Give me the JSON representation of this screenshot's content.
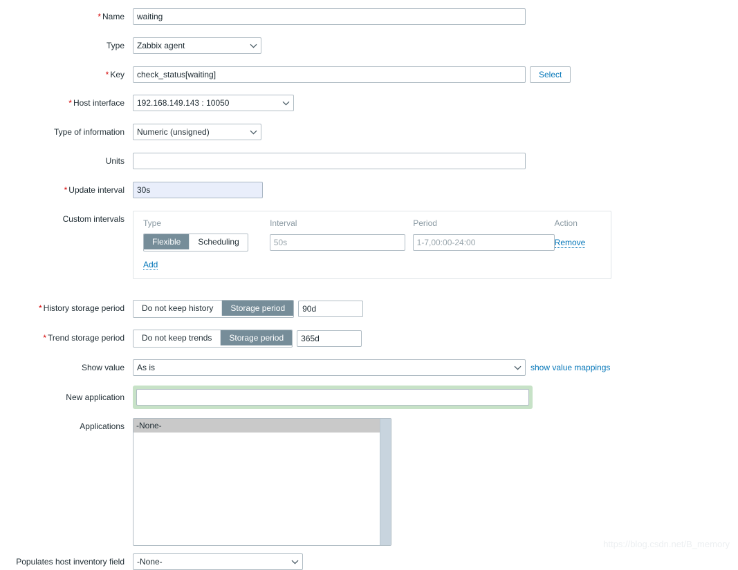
{
  "form": {
    "name": {
      "label": "Name",
      "required": true,
      "value": "waiting"
    },
    "type": {
      "label": "Type",
      "required": false,
      "value": "Zabbix agent"
    },
    "key": {
      "label": "Key",
      "required": true,
      "value": "check_status[waiting]",
      "select_button": "Select"
    },
    "host_interface": {
      "label": "Host interface",
      "required": true,
      "value": "192.168.149.143 : 10050"
    },
    "type_of_information": {
      "label": "Type of information",
      "required": false,
      "value": "Numeric (unsigned)"
    },
    "units": {
      "label": "Units",
      "required": false,
      "value": "",
      "placeholder": ""
    },
    "update_interval": {
      "label": "Update interval",
      "required": true,
      "value": "30s"
    },
    "custom_intervals": {
      "label": "Custom intervals",
      "required": false,
      "columns": {
        "type": "Type",
        "interval": "Interval",
        "period": "Period",
        "action": "Action"
      },
      "rows": [
        {
          "type_options": [
            "Flexible",
            "Scheduling"
          ],
          "type_selected": "Flexible",
          "interval_value": "",
          "interval_placeholder": "50s",
          "period_value": "",
          "period_placeholder": "1-7,00:00-24:00",
          "action_label": "Remove"
        }
      ],
      "add_label": "Add"
    },
    "history_storage_period": {
      "label": "History storage period",
      "required": true,
      "options": [
        "Do not keep history",
        "Storage period"
      ],
      "selected": "Storage period",
      "value": "90d"
    },
    "trend_storage_period": {
      "label": "Trend storage period",
      "required": true,
      "options": [
        "Do not keep trends",
        "Storage period"
      ],
      "selected": "Storage period",
      "value": "365d"
    },
    "show_value": {
      "label": "Show value",
      "required": false,
      "value": "As is",
      "link_label": "show value mappings"
    },
    "new_application": {
      "label": "New application",
      "required": false,
      "value": "",
      "placeholder": ""
    },
    "applications": {
      "label": "Applications",
      "required": false,
      "options": [
        "-None-"
      ],
      "selected": "-None-"
    },
    "populates_host_inventory_field": {
      "label": "Populates host inventory field",
      "required": false,
      "value": "-None-"
    }
  },
  "watermark": "https://blog.csdn.net/B_memory",
  "colors": {
    "accent_link": "#0275b8",
    "required_asterisk": "#d40000",
    "segment_active_bg": "#768d99",
    "focus_field_bg": "#e9eefb",
    "green_ring": "#c7e2c7",
    "selected_option_bg": "#c9c9c9",
    "border": "#b0bcc4"
  }
}
